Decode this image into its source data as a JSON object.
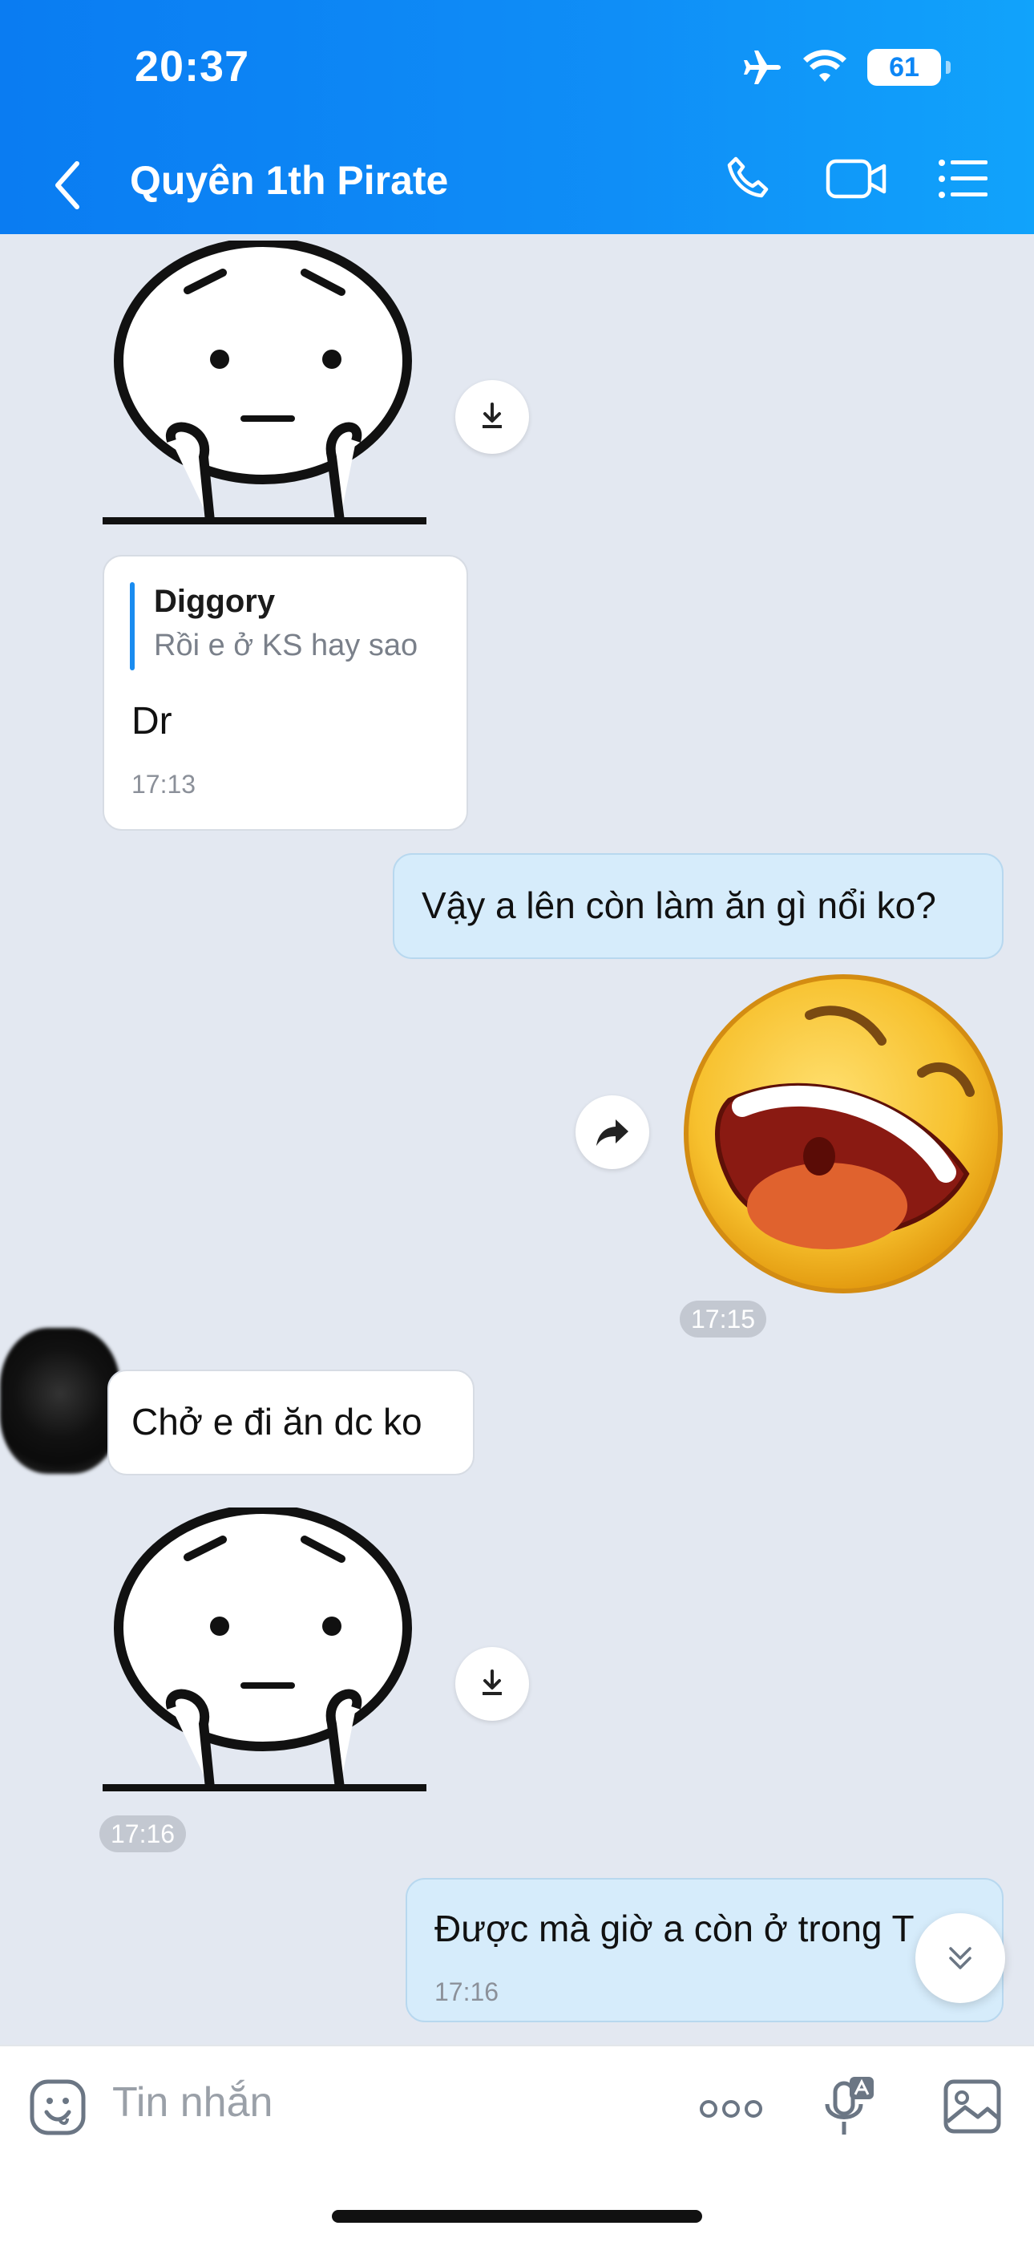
{
  "status_bar": {
    "time": "20:37",
    "battery": "61"
  },
  "header": {
    "title": "Quyên 1th Pirate"
  },
  "messages": {
    "quote": {
      "name": "Diggory",
      "text": "Rồi e ở KS hay sao",
      "reply": "Dr",
      "time": "17:13"
    },
    "outgoing_1": "Vậy a lên còn làm ăn gì nổi ko?",
    "emoji_time": "17:15",
    "incoming_1": "Chở e đi ăn dc ko",
    "sticker_time": "17:16",
    "outgoing_2": {
      "text": "Được mà giờ a còn ở trong T",
      "time": "17:16"
    }
  },
  "composer": {
    "placeholder": "Tin nhắn"
  },
  "colors": {
    "header_start": "#0a7cf2",
    "header_end": "#11a3fb",
    "chat_bg": "#e3e8f1",
    "outgoing_bubble": "#d6ecfb"
  },
  "icons": [
    "back-icon",
    "phone-icon",
    "video-icon",
    "list-icon",
    "download-icon",
    "forward-icon",
    "scroll-down-icon",
    "emoji-icon",
    "more-icon",
    "voice-icon",
    "image-icon"
  ]
}
